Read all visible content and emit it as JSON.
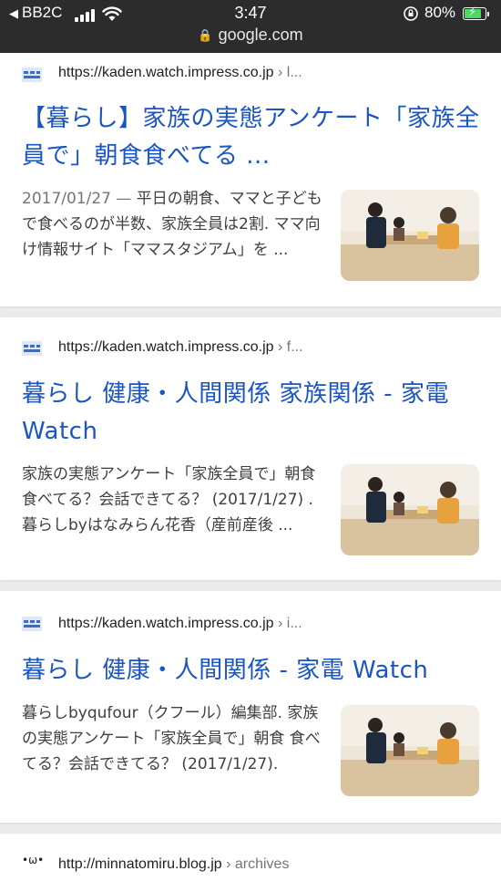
{
  "status_bar": {
    "carrier": "BB2C",
    "time": "3:47",
    "battery_percent": "80%",
    "battery_level": 0.8,
    "url": "google.com"
  },
  "results": [
    {
      "url": "https://kaden.watch.impress.co.jp",
      "crumb": " › l...",
      "title": "【暮らし】家族の実態アンケート「家族全員で」朝食食べてる ...",
      "date": "2017/01/27",
      "snippet": "平日の朝食、ママと子どもで食べるのが半数、家族全員は2割. ママ向け情報サイト「ママスタジアム」を ..."
    },
    {
      "url": "https://kaden.watch.impress.co.jp",
      "crumb": " › f...",
      "title": "暮らし 健康・人間関係 家族関係 - 家電 Watch",
      "date": "",
      "snippet": "家族の実態アンケート「家族全員で」朝食食べてる？会話できてる？ (2017/1/27) . 暮らしbyはなみらん花香（産前産後 ..."
    },
    {
      "url": "https://kaden.watch.impress.co.jp",
      "crumb": " › i...",
      "title": "暮らし 健康・人間関係 - 家電 Watch",
      "date": "",
      "snippet": "暮らしbyqufour（クフール）編集部. 家族の実態アンケート「家族全員で」朝食 食べてる？会話できてる？ (2017/1/27)."
    },
    {
      "favicon_text": "•ω•",
      "url": "http://minnatomiru.blog.jp",
      "crumb": " › archives"
    }
  ],
  "colors": {
    "link": "#1a55c4",
    "status_bg": "#2c2c2c",
    "page_bg": "#ebebeb"
  }
}
